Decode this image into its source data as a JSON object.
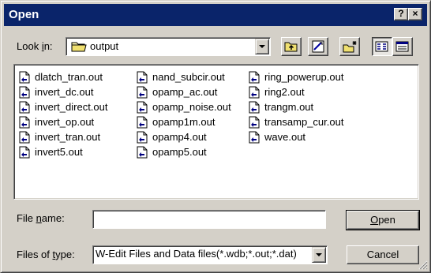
{
  "window": {
    "title": "Open",
    "help_label": "?",
    "close_label": "×"
  },
  "lookin": {
    "label_pre": "Look ",
    "label_key": "i",
    "label_post": "n:",
    "value": "output",
    "folder_icon": "folder-icon"
  },
  "toolbar": {
    "buttons": [
      "up-one-level-icon",
      "desktop-icon",
      "new-folder-icon",
      "list-view-icon",
      "details-view-icon"
    ]
  },
  "files": {
    "icon": "document-icon",
    "col1": [
      "dlatch_tran.out",
      "invert_dc.out",
      "invert_direct.out",
      "invert_op.out",
      "invert_tran.out",
      "invert5.out"
    ],
    "col2": [
      "nand_subcir.out",
      "opamp_ac.out",
      "opamp_noise.out",
      "opamp1m.out",
      "opamp4.out",
      "opamp5.out"
    ],
    "col3": [
      "ring_powerup.out",
      "ring2.out",
      "trangm.out",
      "transamp_cur.out",
      "wave.out"
    ]
  },
  "filename": {
    "label_pre": "File ",
    "label_key": "n",
    "label_post": "ame:",
    "value": ""
  },
  "filetype": {
    "label_pre": "Files of ",
    "label_key": "t",
    "label_post": "ype:",
    "value": "W-Edit Files and Data files(*.wdb;*.out;*.dat)"
  },
  "buttons": {
    "open_key": "O",
    "open_rest": "pen",
    "cancel": "Cancel"
  },
  "colors": {
    "titlebar": "#0a246a",
    "face": "#d4d0c8"
  }
}
